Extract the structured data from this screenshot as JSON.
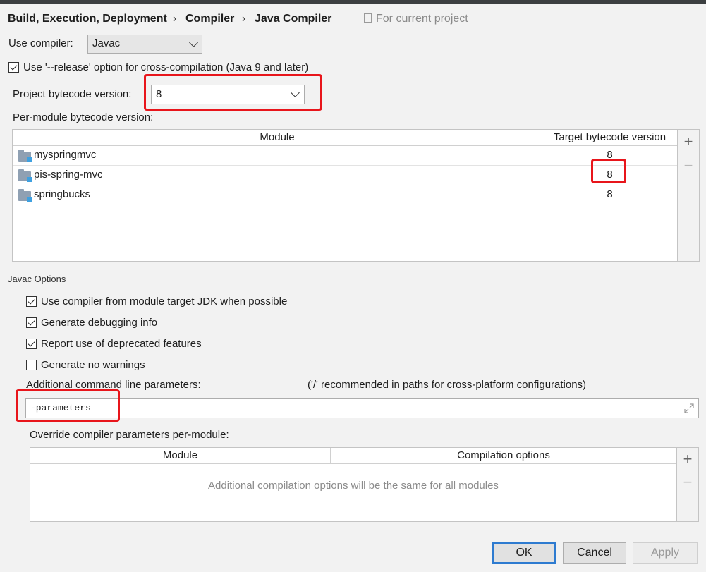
{
  "breadcrumb": {
    "items": [
      "Build, Execution, Deployment",
      "Compiler",
      "Java Compiler"
    ],
    "separator": "›",
    "scope": "For current project"
  },
  "compiler": {
    "use_compiler_label": "Use compiler:",
    "use_compiler_value": "Javac",
    "release_option_label": "Use '--release' option for cross-compilation (Java 9 and later)",
    "release_option_checked": true,
    "project_bytecode_label": "Project bytecode version:",
    "project_bytecode_value": "8",
    "per_module_label": "Per-module bytecode version:"
  },
  "module_table": {
    "columns": [
      "Module",
      "Target bytecode version"
    ],
    "rows": [
      {
        "module": "myspringmvc",
        "version": "8"
      },
      {
        "module": "pis-spring-mvc",
        "version": "8"
      },
      {
        "module": "springbucks",
        "version": "8"
      }
    ],
    "add_symbol": "+",
    "remove_symbol": "−"
  },
  "javac_options": {
    "group_title": "Javac Options",
    "checkboxes": [
      {
        "label": "Use compiler from module target JDK when possible",
        "checked": true
      },
      {
        "label": "Generate debugging info",
        "checked": true
      },
      {
        "label": "Report use of deprecated features",
        "checked": true
      },
      {
        "label": "Generate no warnings",
        "checked": false
      }
    ],
    "params_label": "Additional command line parameters:",
    "params_hint": "('/' recommended in paths for cross-platform configurations)",
    "params_value": "-parameters",
    "override_label": "Override compiler parameters per-module:"
  },
  "override_table": {
    "columns": [
      "Module",
      "Compilation options"
    ],
    "empty_text": "Additional compilation options will be the same for all modules",
    "add_symbol": "+",
    "remove_symbol": "−"
  },
  "buttons": {
    "ok": "OK",
    "cancel": "Cancel",
    "apply": "Apply"
  },
  "colors": {
    "highlight": "#e8151b",
    "ok_border": "#2e7bd0"
  }
}
